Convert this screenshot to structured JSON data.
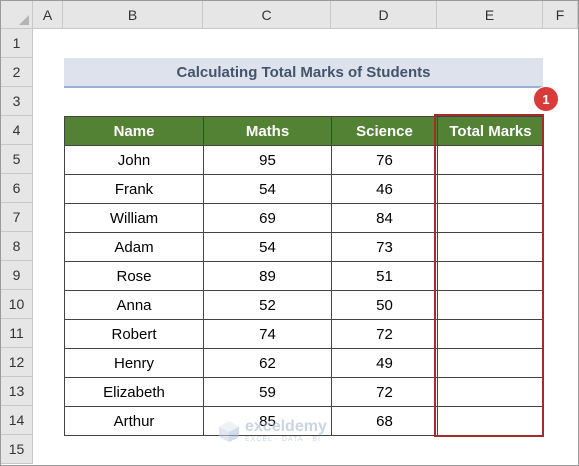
{
  "columns": [
    "A",
    "B",
    "C",
    "D",
    "E",
    "F"
  ],
  "rows": [
    "1",
    "2",
    "3",
    "4",
    "5",
    "6",
    "7",
    "8",
    "9",
    "10",
    "11",
    "12",
    "13",
    "14",
    "15"
  ],
  "title": "Calculating Total Marks of Students",
  "table": {
    "headers": {
      "name": "Name",
      "maths": "Maths",
      "science": "Science",
      "total": "Total Marks"
    },
    "rows": [
      {
        "name": "John",
        "maths": "95",
        "science": "76",
        "total": ""
      },
      {
        "name": "Frank",
        "maths": "54",
        "science": "46",
        "total": ""
      },
      {
        "name": "William",
        "maths": "69",
        "science": "84",
        "total": ""
      },
      {
        "name": "Adam",
        "maths": "54",
        "science": "73",
        "total": ""
      },
      {
        "name": "Rose",
        "maths": "89",
        "science": "51",
        "total": ""
      },
      {
        "name": "Anna",
        "maths": "52",
        "science": "50",
        "total": ""
      },
      {
        "name": "Robert",
        "maths": "74",
        "science": "72",
        "total": ""
      },
      {
        "name": "Henry",
        "maths": "62",
        "science": "49",
        "total": ""
      },
      {
        "name": "Elizabeth",
        "maths": "59",
        "science": "72",
        "total": ""
      },
      {
        "name": "Arthur",
        "maths": "85",
        "science": "68",
        "total": ""
      }
    ]
  },
  "annotation": {
    "step": "1"
  },
  "watermark": {
    "name": "exceldemy",
    "tagline": "EXCEL · DATA · BI",
    "icon": "exceldemy-logo-icon"
  },
  "colors": {
    "header_fill": "#548235",
    "title_fill": "#dde2ec",
    "highlight": "#a62b2b",
    "badge": "#d93a3a"
  }
}
